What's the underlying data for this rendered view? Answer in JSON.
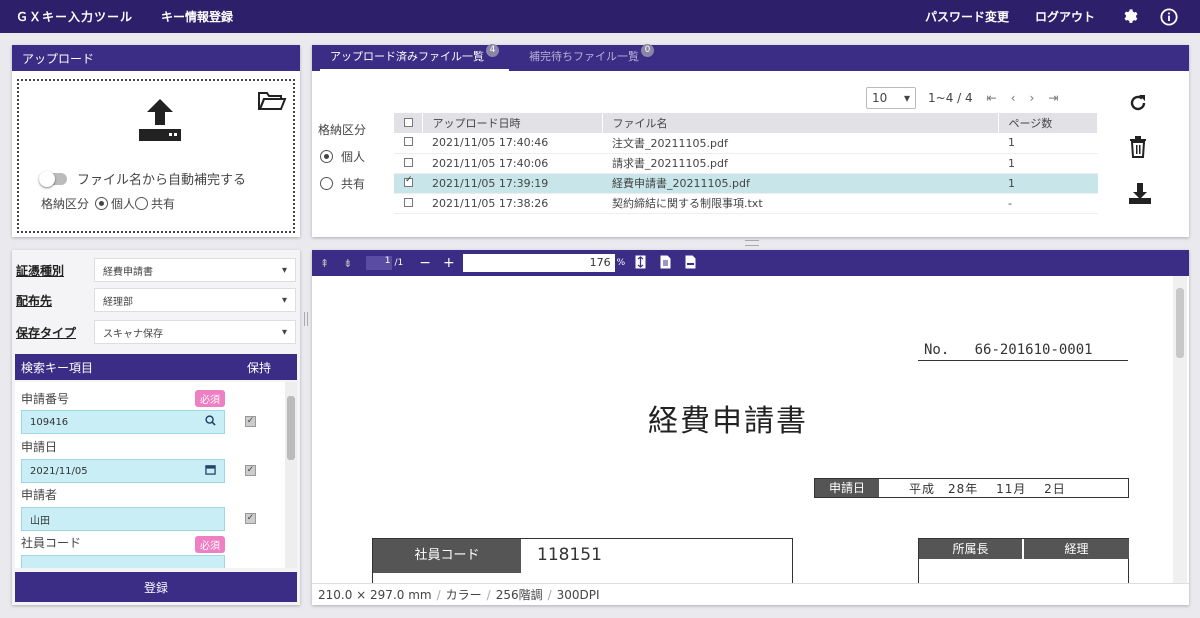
{
  "header": {
    "app_title": "ＧＸキー入力ツール",
    "menu_item": "キー情報登録",
    "password_link": "パスワード変更",
    "logout_link": "ログアウト",
    "icons": [
      "gear-icon",
      "info-icon"
    ]
  },
  "upload": {
    "title": "アップロード",
    "autocomplete_label": "ファイル名から自動補完する",
    "class_label": "格納区分",
    "option_personal": "個人",
    "option_shared": "共有"
  },
  "filelist": {
    "tab_uploaded": "アップロード済みファイル一覧",
    "tab_uploaded_count": "4",
    "tab_pending": "補完待ちファイル一覧",
    "tab_pending_count": "0",
    "page_size": "10",
    "range": "1~4 / 4",
    "nav": {
      "first": "⇤",
      "prev": "‹",
      "next": "›",
      "last": "⇥"
    },
    "storage_label": "格納区分",
    "storage_personal": "個人",
    "storage_shared": "共有",
    "columns": [
      "アップロード日時",
      "ファイル名",
      "ページ数"
    ],
    "rows": [
      {
        "datetime": "2021/11/05 17:40:46",
        "name": "注文書_20211105.pdf",
        "pages": "1",
        "checked": false
      },
      {
        "datetime": "2021/11/05 17:40:06",
        "name": "請求書_20211105.pdf",
        "pages": "1",
        "checked": false
      },
      {
        "datetime": "2021/11/05 17:39:19",
        "name": "経費申請書_20211105.pdf",
        "pages": "1",
        "checked": true
      },
      {
        "datetime": "2021/11/05 17:38:26",
        "name": "契約締結に関する制限事項.txt",
        "pages": "-",
        "checked": false
      }
    ]
  },
  "form": {
    "doc_type_label": "証憑種別",
    "doc_type_value": "経費申請書",
    "dest_label": "配布先",
    "dest_value": "経理部",
    "save_type_label": "保存タイプ",
    "save_type_value": "スキャナ保存",
    "key_header": "検索キー項目",
    "keep_header": "保持",
    "required_badge": "必須",
    "fields": [
      {
        "label": "申請番号",
        "value": "109416"
      },
      {
        "label": "申請日",
        "value": "2021/11/05"
      },
      {
        "label": "申請者",
        "value": "山田"
      },
      {
        "label": "社員コード",
        "value": ""
      }
    ],
    "register_button": "登録"
  },
  "viewer": {
    "page_current": "1",
    "page_total": "/1",
    "zoom": "176",
    "zoom_unit": "%",
    "doc": {
      "no_label": "No.",
      "no_value": "66-201610-0001",
      "title": "経費申請書",
      "date_label": "申請日",
      "date_value": "平成　28年　 11月　 2日",
      "emp_label": "社員コード",
      "emp_value": "118151",
      "stamp1": "所属長",
      "stamp2": "経理"
    },
    "status": {
      "size": "210.0 × 297.0 mm",
      "color": "カラー",
      "tone": "256階調",
      "dpi": "300DPI"
    }
  }
}
